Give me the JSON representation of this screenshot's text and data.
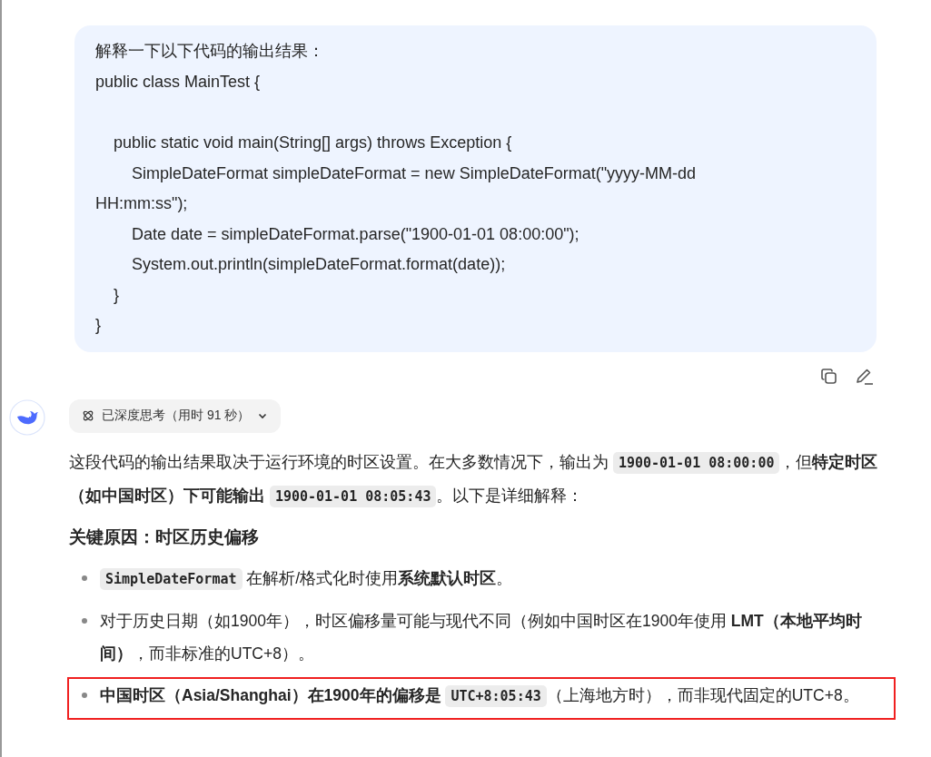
{
  "user_message": {
    "blocks": [
      [
        "解释一下以下代码的输出结果：",
        "public class MainTest {"
      ],
      [
        "    public static void main(String[] args) throws Exception {",
        "        SimpleDateFormat simpleDateFormat = new SimpleDateFormat(\"yyyy-MM-dd",
        "HH:mm:ss\");",
        "        Date date = simpleDateFormat.parse(\"1900-01-01 08:00:00\");",
        "        System.out.println(simpleDateFormat.format(date));",
        "    }",
        "}"
      ]
    ]
  },
  "thinking": {
    "label": "已深度思考（用时 91 秒）",
    "expanded": false
  },
  "answer": {
    "paragraph": [
      {
        "kind": "plain",
        "text": "这段代码的输出结果取决于运行环境的时区设置。在大多数情况下，输出为 "
      },
      {
        "kind": "code",
        "text": "1900-01-01 08:00:00"
      },
      {
        "kind": "plain",
        "text": "，但"
      },
      {
        "kind": "bold",
        "text": "特定时区（如中国时区）下可能输出 "
      },
      {
        "kind": "code",
        "text": "1900-01-01 08:05:43"
      },
      {
        "kind": "plain",
        "text": "。以下是详细解释："
      }
    ],
    "heading": "关键原因：时区历史偏移",
    "bullets": [
      {
        "highlighted": false,
        "segments": [
          {
            "kind": "code",
            "text": "SimpleDateFormat"
          },
          {
            "kind": "plain",
            "text": " 在解析/格式化时使用"
          },
          {
            "kind": "bold",
            "text": "系统默认时区"
          },
          {
            "kind": "plain",
            "text": "。"
          }
        ]
      },
      {
        "highlighted": false,
        "segments": [
          {
            "kind": "plain",
            "text": "对于历史日期（如1900年），时区偏移量可能与现代不同（例如中国时区在1900年使用 "
          },
          {
            "kind": "bold",
            "text": "LMT（本地平均时间）"
          },
          {
            "kind": "plain",
            "text": "，而非标准的UTC+8）。"
          }
        ]
      },
      {
        "highlighted": true,
        "segments": [
          {
            "kind": "bold",
            "text": "中国时区（Asia/Shanghai）在1900年的偏移是 "
          },
          {
            "kind": "code",
            "text": "UTC+8:05:43"
          },
          {
            "kind": "plain",
            "text": "（上海地方时），而非现代固定的UTC+8。"
          }
        ]
      }
    ]
  }
}
